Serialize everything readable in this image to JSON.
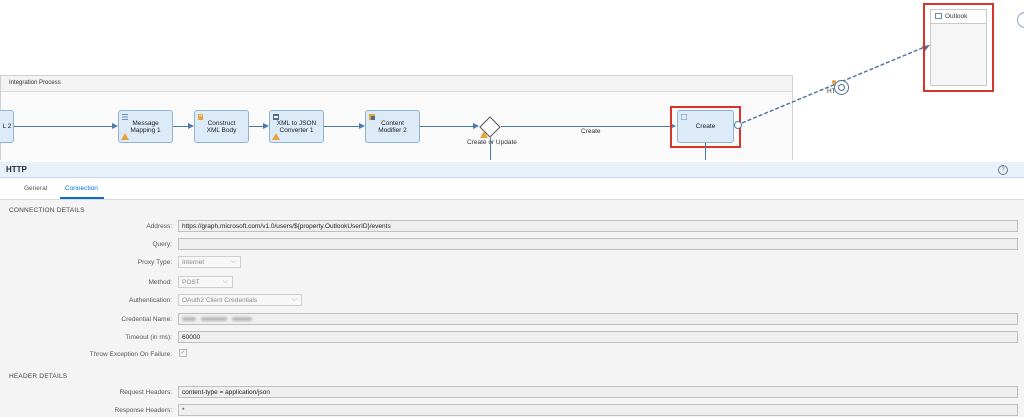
{
  "canvas": {
    "pool_title": "Integration Process",
    "tasks": {
      "partial_label": "L 2",
      "message_mapping": "Message Mapping 1",
      "construct_xml": "Construct XML Body",
      "xml_to_json": "XML to JSON Converter 1",
      "content_modifier": "Content Modifier 2",
      "create": "Create"
    },
    "gateway_label": "Create or Update",
    "route_label": "Create",
    "adapter_label": "HT",
    "participant": "Outlook",
    "colors": {
      "highlight": "#d9342b",
      "task_fill": "#dcebf7",
      "connector": "#4e7aa6",
      "warning": "#e8a33b"
    }
  },
  "panel": {
    "title": "HTTP",
    "help_icon": "?",
    "tabs": [
      {
        "label": "General"
      },
      {
        "label": "Connection"
      }
    ],
    "active_tab": "Connection",
    "connection_section": "CONNECTION DETAILS",
    "fields": {
      "address": {
        "label": "Address:",
        "value": "https://graph.microsoft.com/v1.0/users/${property.OutlookUserID}/events"
      },
      "query": {
        "label": "Query:",
        "value": ""
      },
      "proxy_type": {
        "label": "Proxy Type:",
        "value": "Internet"
      },
      "method": {
        "label": "Method:",
        "value": "POST"
      },
      "authentication": {
        "label": "Authentication:",
        "value": "OAuth2 Client Credentials"
      },
      "credential_name": {
        "label": "Credential Name:"
      },
      "timeout": {
        "label": "Timeout (in ms):",
        "value": "60000"
      },
      "throw_exception": {
        "label": "Throw Exception On Failure:",
        "checked": true
      }
    },
    "header_section": "HEADER DETAILS",
    "headers": {
      "request": {
        "label": "Request Headers:",
        "value": "content-type = application/json"
      },
      "response": {
        "label": "Response Headers:",
        "value": "*"
      }
    }
  }
}
